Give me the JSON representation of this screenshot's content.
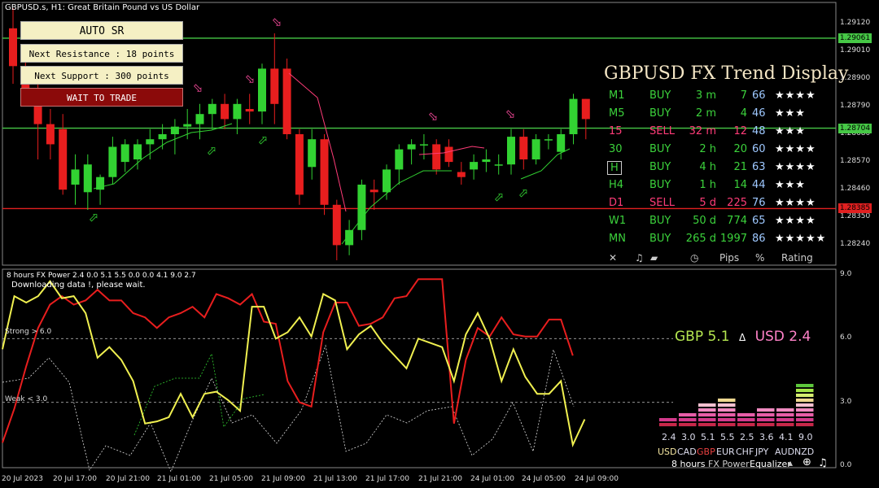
{
  "header": {
    "symbol_text": "GBPUSD.s, H1:  Great Britain Pound vs US Dollar",
    "indicator_text": "8 hours FX Power 2.4 0.0 5.1 5.5 0.0 0.0 4.1 9.0 2.7",
    "download_text": "Downloading data !, please wait."
  },
  "panel": {
    "auto_sr_label": "AUTO SR",
    "next_resistance_label": "Next Resistance : 18 points",
    "next_support_label": "Next Support : 300 points",
    "wait_label": "WAIT TO TRADE"
  },
  "trend_display": {
    "title": "GBPUSD FX Trend Display",
    "rows": [
      {
        "tf": "M1",
        "dir": "BUY",
        "dur": "3 m",
        "pips": "7",
        "pct": "66",
        "stars": "★★★★",
        "color": "#3cd23c"
      },
      {
        "tf": "M5",
        "dir": "BUY",
        "dur": "2 m",
        "pips": "4",
        "pct": "46",
        "stars": "★★★",
        "color": "#3cd23c"
      },
      {
        "tf": "15",
        "dir": "SELL",
        "dur": "32 m",
        "pips": "12",
        "pct": "48",
        "stars": "★★★",
        "color": "#ff3c78"
      },
      {
        "tf": "30",
        "dir": "BUY",
        "dur": "2 h",
        "pips": "20",
        "pct": "60",
        "stars": "★★★★",
        "color": "#3cd23c"
      },
      {
        "tf": "H",
        "dir": "BUY",
        "dur": "4 h",
        "pips": "21",
        "pct": "63",
        "stars": "★★★★",
        "color": "#3cd23c"
      },
      {
        "tf": "H4",
        "dir": "BUY",
        "dur": "1 h",
        "pips": "14",
        "pct": "44",
        "stars": "★★★",
        "color": "#3cd23c"
      },
      {
        "tf": "D1",
        "dir": "SELL",
        "dur": "5 d",
        "pips": "225",
        "pct": "76",
        "stars": "★★★★",
        "color": "#ff3c78"
      },
      {
        "tf": "W1",
        "dir": "BUY",
        "dur": "50 d",
        "pips": "774",
        "pct": "65",
        "stars": "★★★★",
        "color": "#3cd23c"
      },
      {
        "tf": "MN",
        "dir": "BUY",
        "dur": "265 d",
        "pips": "1997",
        "pct": "86",
        "stars": "★★★★★",
        "color": "#3cd23c"
      }
    ],
    "footer": {
      "close": "✕",
      "sound": "♫",
      "pips": "Pips",
      "pct": "%",
      "rating": "Rating"
    }
  },
  "price_axis": [
    "1.29120",
    "1.29010",
    "1.28900",
    "1.28790",
    "1.28680",
    "1.28570",
    "1.28460",
    "1.28350",
    "1.28240"
  ],
  "price_boxes": [
    {
      "label": "1.29061",
      "color": "#46c846"
    },
    {
      "label": "1.28704",
      "color": "#46c846"
    },
    {
      "label": "1.28385",
      "color": "#e02020"
    }
  ],
  "lower_axis": [
    "9.0",
    "6.0",
    "3.0",
    "0.0"
  ],
  "strong_label": "Strong > 6.0",
  "weak_label": "Weak < 3.0",
  "time_axis": [
    "20 Jul 2023",
    "20 Jul 17:00",
    "20 Jul 21:00",
    "21 Jul 01:00",
    "21 Jul 05:00",
    "21 Jul 09:00",
    "21 Jul 13:00",
    "21 Jul 17:00",
    "21 Jul 21:00",
    "24 Jul 01:00",
    "24 Jul 05:00",
    "24 Jul 09:00"
  ],
  "strength": {
    "base_label": "GBP 5.1",
    "delta": "Δ",
    "quote_label": "USD 2.4",
    "currencies": [
      "USD",
      "CAD",
      "GBP",
      "EUR",
      "CHF",
      "JPY",
      "AUD",
      "NZD"
    ],
    "values": [
      "2.4",
      "3.0",
      "5.1",
      "5.5",
      "2.5",
      "3.6",
      "4.1",
      "9.0"
    ],
    "bottom": {
      "period": "8 hours",
      "name": "FX Power",
      "eq": "Equalizer"
    }
  },
  "colors": {
    "bull": "#32d232",
    "bear": "#e81e1e",
    "gbp": "#b4e650",
    "usd": "#ff82c8"
  },
  "chart_data": [
    {
      "type": "candlestick",
      "title": "GBPUSD.s, H1:  Great Britain Pound vs US Dollar",
      "ylim": [
        1.2818,
        1.2918
      ],
      "levels": [
        1.29061,
        1.28704,
        1.28385
      ],
      "candles": [
        [
          1.291,
          1.2918,
          1.2888,
          1.2895
        ],
        [
          1.2895,
          1.29,
          1.288,
          1.2884
        ],
        [
          1.288,
          1.2888,
          1.2858,
          1.2872
        ],
        [
          1.2872,
          1.2878,
          1.2858,
          1.2864
        ],
        [
          1.287,
          1.2876,
          1.2844,
          1.2846
        ],
        [
          1.2848,
          1.286,
          1.284,
          1.2854
        ],
        [
          1.2845,
          1.286,
          1.2838,
          1.2856
        ],
        [
          1.2846,
          1.2852,
          1.284,
          1.2851
        ],
        [
          1.2851,
          1.2867,
          1.2848,
          1.2863
        ],
        [
          1.2857,
          1.2866,
          1.2853,
          1.2864
        ],
        [
          1.2858,
          1.2866,
          1.2854,
          1.2864
        ],
        [
          1.2864,
          1.287,
          1.2858,
          1.2866
        ],
        [
          1.2866,
          1.2872,
          1.2862,
          1.2868
        ],
        [
          1.2868,
          1.2874,
          1.286,
          1.2871
        ],
        [
          1.2871,
          1.2878,
          1.2866,
          1.2872
        ],
        [
          1.2872,
          1.288,
          1.2866,
          1.2876
        ],
        [
          1.2876,
          1.2882,
          1.287,
          1.288
        ],
        [
          1.288,
          1.2884,
          1.287,
          1.2874
        ],
        [
          1.2874,
          1.2882,
          1.2868,
          1.288
        ],
        [
          1.2878,
          1.2884,
          1.2872,
          1.2877
        ],
        [
          1.2877,
          1.2896,
          1.2872,
          1.2894
        ],
        [
          1.2894,
          1.2908,
          1.2872,
          1.288
        ],
        [
          1.2894,
          1.2898,
          1.2866,
          1.2868
        ],
        [
          1.2868,
          1.287,
          1.284,
          1.2844
        ],
        [
          1.2855,
          1.287,
          1.285,
          1.2866
        ],
        [
          1.2866,
          1.2868,
          1.2836,
          1.284
        ],
        [
          1.284,
          1.2842,
          1.2818,
          1.2824
        ],
        [
          1.2824,
          1.2834,
          1.282,
          1.283
        ],
        [
          1.283,
          1.285,
          1.2826,
          1.2848
        ],
        [
          1.2846,
          1.285,
          1.2838,
          1.2845
        ],
        [
          1.2845,
          1.2856,
          1.2842,
          1.2854
        ],
        [
          1.2854,
          1.2864,
          1.2848,
          1.2862
        ],
        [
          1.2862,
          1.2866,
          1.2856,
          1.2864
        ],
        [
          1.2864,
          1.2868,
          1.2858,
          1.2864
        ],
        [
          1.2864,
          1.2866,
          1.2852,
          1.2854
        ],
        [
          1.2863,
          1.2866,
          1.2855,
          1.2857
        ],
        [
          1.2853,
          1.2857,
          1.2848,
          1.2851
        ],
        [
          1.2854,
          1.286,
          1.285,
          1.2857
        ],
        [
          1.2857,
          1.2862,
          1.2853,
          1.2858
        ],
        [
          1.2856,
          1.286,
          1.2852,
          1.2856
        ],
        [
          1.2856,
          1.287,
          1.2852,
          1.2867
        ],
        [
          1.2867,
          1.287,
          1.2854,
          1.2858
        ],
        [
          1.2858,
          1.2868,
          1.2856,
          1.2866
        ],
        [
          1.2866,
          1.2868,
          1.2862,
          1.2866
        ],
        [
          1.2861,
          1.287,
          1.2858,
          1.2868
        ],
        [
          1.2868,
          1.2884,
          1.2864,
          1.2882
        ],
        [
          1.2882,
          1.2882,
          1.2866,
          1.2874
        ]
      ]
    },
    {
      "type": "line",
      "title": "8 hours FX Power 2.4 0.0 5.1 5.5 0.0 0.0 4.1 9.0 2.7",
      "ylim": [
        0,
        9
      ],
      "series": [
        {
          "values": [
            1.1,
            2.7,
            4.7,
            6.5,
            7.6,
            8.0,
            7.6,
            7.8,
            8.3,
            7.8,
            7.8,
            7.2,
            7.0,
            6.5,
            7.0,
            7.2,
            7.5,
            7.0,
            8.1,
            7.9,
            7.6,
            8.1,
            6.8,
            6.7,
            4.0,
            3.0,
            2.8,
            6.3,
            7.7,
            7.7,
            6.6,
            6.7,
            7.0,
            7.9,
            8.0,
            8.8,
            8.8,
            8.8,
            2.0,
            5.0,
            6.5,
            6.1,
            7.0,
            6.2,
            6.1,
            6.1,
            6.9,
            6.9,
            5.2
          ]
        },
        {
          "values": [
            5.5,
            8.0,
            7.7,
            8.0,
            8.7,
            7.9,
            8.0,
            7.2,
            5.1,
            5.6,
            5.0,
            4.0,
            2.0,
            2.1,
            2.3,
            3.4,
            2.3,
            3.4,
            3.5,
            3.1,
            2.6,
            7.5,
            7.5,
            6.0,
            6.3,
            7.0,
            6.1,
            8.1,
            7.8,
            5.5,
            6.2,
            6.6,
            5.8,
            5.2,
            4.6,
            6.0,
            5.8,
            5.6,
            4.0,
            6.2,
            7.2,
            6.0,
            4.0,
            5.5,
            4.2,
            3.4,
            3.4,
            4.0,
            1.0,
            2.2
          ]
        }
      ]
    },
    {
      "type": "bar",
      "title": "Equalizer",
      "categories": [
        "USD",
        "CAD",
        "GBP",
        "EUR",
        "CHF",
        "JPY",
        "AUD",
        "NZD"
      ],
      "values": [
        2.4,
        3.0,
        5.1,
        5.5,
        2.5,
        3.6,
        4.1,
        9.0
      ],
      "ylim": [
        0,
        9
      ]
    }
  ]
}
